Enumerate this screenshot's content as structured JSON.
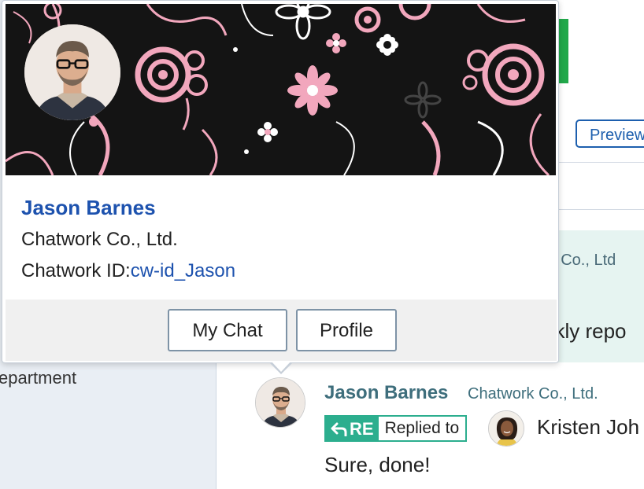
{
  "background": {
    "left_label": "epartment",
    "preview_label": "Preview",
    "company_partial": "rk Co., Ltd",
    "message_partial": "ekly repo"
  },
  "message": {
    "sender_name": "Jason Barnes",
    "sender_company": "Chatwork Co., Ltd.",
    "re_label": "RE",
    "replied_label": "Replied to",
    "reply_to_name": "Kristen Joh",
    "body": "Sure, done!"
  },
  "profile_card": {
    "name": "Jason Barnes",
    "company": "Chatwork Co., Ltd.",
    "id_label": "Chatwork ID:",
    "id_value": "cw-id_Jason",
    "my_chat_label": "My Chat",
    "profile_label": "Profile"
  },
  "colors": {
    "link_blue": "#1d52ae",
    "re_green": "#2cae8e",
    "cover_bg": "#141414",
    "cover_pink": "#f2a7bd"
  }
}
